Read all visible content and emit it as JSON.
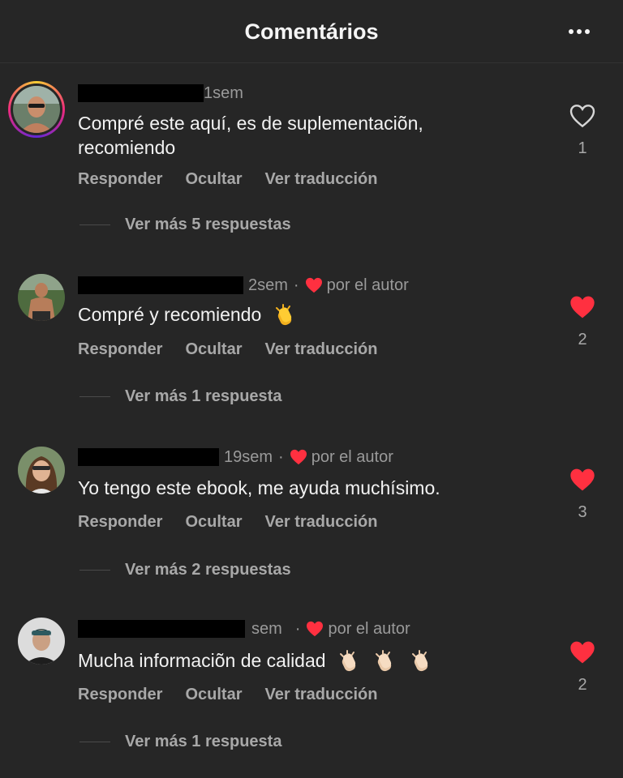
{
  "header": {
    "title": "Comentários",
    "more_icon": "more-horizontal-icon"
  },
  "colors": {
    "background": "#262626",
    "like_red": "#ff3040",
    "muted": "#a8a8a8"
  },
  "comments": [
    {
      "time": "1sem",
      "liked_by_author": false,
      "author_label": "",
      "text": "Compré este aquí, es de suplementaciõn,",
      "text_line2": "recomiendo",
      "actions": [
        "Responder",
        "Ocultar",
        "Ver traducción"
      ],
      "more_replies": "Ver más 5 respuestas",
      "likes": "1",
      "liked": false
    },
    {
      "time": "2sem",
      "liked_by_author": true,
      "author_label": "por el autor",
      "text": "Compré y recomiendo",
      "emoji": "clapping-hands",
      "actions": [
        "Responder",
        "Ocultar",
        "Ver traducción"
      ],
      "more_replies": "Ver más 1 respuesta",
      "likes": "2",
      "liked": true
    },
    {
      "time": "19sem",
      "liked_by_author": true,
      "author_label": "por el autor",
      "text": "Yo tengo este ebook, me ayuda muchísimo.",
      "actions": [
        "Responder",
        "Ocultar",
        "Ver traducción"
      ],
      "more_replies": "Ver más 2 respuestas",
      "likes": "3",
      "liked": true
    },
    {
      "time": "sem",
      "liked_by_author": true,
      "author_label": "por el autor",
      "text": "Mucha informaciõn de calidad",
      "emoji": "clapping-hands-x3",
      "actions": [
        "Responder",
        "Ocultar",
        "Ver traducción"
      ],
      "more_replies": "Ver más 1 respuesta",
      "likes": "2",
      "liked": true
    }
  ]
}
